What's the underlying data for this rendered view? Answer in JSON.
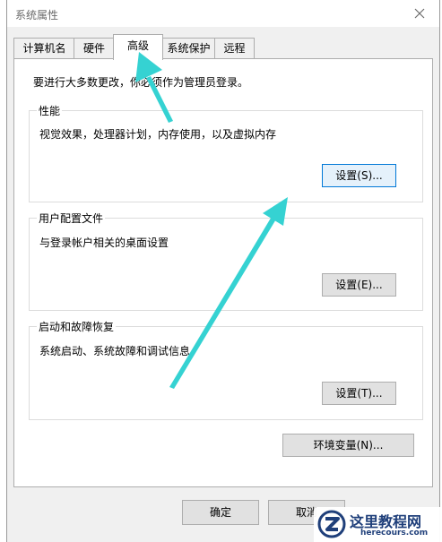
{
  "window": {
    "title": "系统属性"
  },
  "tabs": [
    {
      "label": "计算机名"
    },
    {
      "label": "硬件"
    },
    {
      "label": "高级"
    },
    {
      "label": "系统保护"
    },
    {
      "label": "远程"
    }
  ],
  "admin_note": "要进行大多数更改，你必须作为管理员登录。",
  "groups": {
    "performance": {
      "title": "性能",
      "description": "视觉效果，处理器计划，内存使用，以及虚拟内存",
      "button": "设置(S)..."
    },
    "user_profiles": {
      "title": "用户配置文件",
      "description": "与登录帐户相关的桌面设置",
      "button": "设置(E)..."
    },
    "startup_recovery": {
      "title": "启动和故障恢复",
      "description": "系统启动、系统故障和调试信息",
      "button": "设置(T)..."
    }
  },
  "env_button": "环境变量(N)...",
  "footer": {
    "ok": "确定",
    "cancel": "取消"
  },
  "watermark": {
    "title": "这里教程网",
    "url": "herecours.com"
  },
  "colors": {
    "arrow": "#35d2d2",
    "watermark_text": "#1f3f7a"
  }
}
